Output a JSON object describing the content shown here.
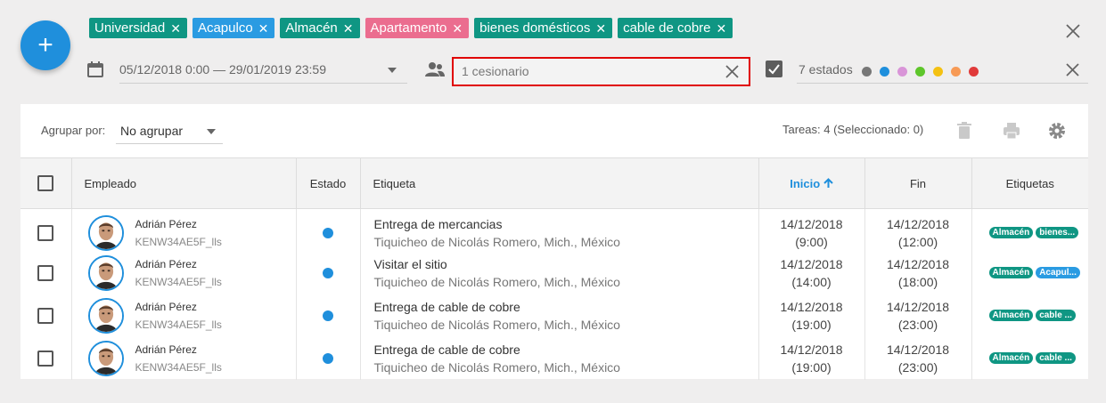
{
  "fab": {
    "label": "+"
  },
  "tags": [
    {
      "label": "Universidad",
      "color": "#0f9683"
    },
    {
      "label": "Acapulco",
      "color": "#2a9be2"
    },
    {
      "label": "Almacén",
      "color": "#0f9683"
    },
    {
      "label": "Apartamento",
      "color": "#eb6d8f"
    },
    {
      "label": "bienes domésticos",
      "color": "#0f9683"
    },
    {
      "label": "cable de cobre",
      "color": "#0f9683"
    }
  ],
  "filters": {
    "date_range": "05/12/2018 0:00 — 29/01/2019 23:59",
    "assignee": "1 cesionario",
    "states_label": "7 estados",
    "state_colors": [
      "#777777",
      "#1f8fdc",
      "#d995d8",
      "#5ec62b",
      "#f4c112",
      "#f79a55",
      "#e03a3a"
    ]
  },
  "toolbar": {
    "group_label": "Agrupar por:",
    "group_value": "No agrupar",
    "count_text": "Tareas: 4 (Seleccionado: 0)"
  },
  "columns": {
    "employee": "Empleado",
    "state": "Estado",
    "label": "Etiqueta",
    "start": "Inicio",
    "end": "Fin",
    "tags": "Etiquetas"
  },
  "rows": [
    {
      "name": "Adrián Pérez",
      "code": "KENW34AE5F_lls",
      "state_color": "#1f8fdc",
      "title": "Entrega de mercancias",
      "place": "Tiquicheo de Nicolás Romero, Mich., México",
      "start_date": "14/12/2018",
      "start_time": "(9:00)",
      "end_date": "14/12/2018",
      "end_time": "(12:00)",
      "tags": [
        {
          "label": "Almacén",
          "color": "#0f9683"
        },
        {
          "label": "bienes...",
          "color": "#0f9683"
        }
      ]
    },
    {
      "name": "Adrián Pérez",
      "code": "KENW34AE5F_lls",
      "state_color": "#1f8fdc",
      "title": "Visitar el sitio",
      "place": "Tiquicheo de Nicolás Romero, Mich., México",
      "start_date": "14/12/2018",
      "start_time": "(14:00)",
      "end_date": "14/12/2018",
      "end_time": "(18:00)",
      "tags": [
        {
          "label": "Almacén",
          "color": "#0f9683"
        },
        {
          "label": "Acapul...",
          "color": "#2a9be2"
        }
      ]
    },
    {
      "name": "Adrián Pérez",
      "code": "KENW34AE5F_lls",
      "state_color": "#1f8fdc",
      "title": "Entrega de cable de cobre",
      "place": "Tiquicheo de Nicolás Romero, Mich., México",
      "start_date": "14/12/2018",
      "start_time": "(19:00)",
      "end_date": "14/12/2018",
      "end_time": "(23:00)",
      "tags": [
        {
          "label": "Almacén",
          "color": "#0f9683"
        },
        {
          "label": "cable ...",
          "color": "#0f9683"
        }
      ]
    },
    {
      "name": "Adrián Pérez",
      "code": "KENW34AE5F_lls",
      "state_color": "#1f8fdc",
      "title": "Entrega de cable de cobre",
      "place": "Tiquicheo de Nicolás Romero, Mich., México",
      "start_date": "14/12/2018",
      "start_time": "(19:00)",
      "end_date": "14/12/2018",
      "end_time": "(23:00)",
      "tags": [
        {
          "label": "Almacén",
          "color": "#0f9683"
        },
        {
          "label": "cable ...",
          "color": "#0f9683"
        }
      ]
    }
  ]
}
